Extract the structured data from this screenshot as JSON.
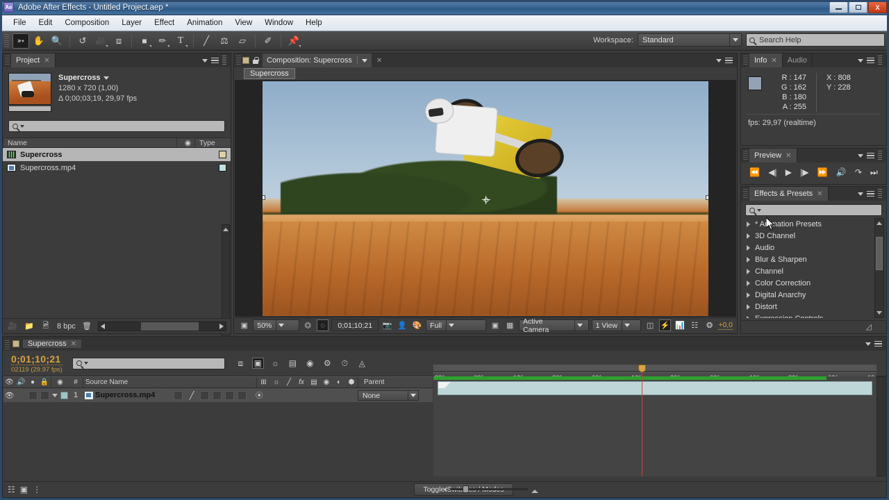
{
  "window": {
    "title": "Adobe After Effects - Untitled Project.aep *",
    "app_badge": "Ae",
    "minimize_label": "Minimize",
    "maximize_label": "Maximize",
    "close_label": "X"
  },
  "menubar": {
    "items": [
      "File",
      "Edit",
      "Composition",
      "Layer",
      "Effect",
      "Animation",
      "View",
      "Window",
      "Help"
    ]
  },
  "toolbar": {
    "tools": [
      {
        "name": "selection-tool",
        "glyph": "↖",
        "active": true
      },
      {
        "name": "hand-tool",
        "glyph": "✋",
        "active": false
      },
      {
        "name": "zoom-tool",
        "glyph": "🔍",
        "active": false
      },
      {
        "name": "rotation-tool",
        "glyph": "↺",
        "active": false
      },
      {
        "name": "camera-tool",
        "glyph": "🎥",
        "active": false
      },
      {
        "name": "pan-behind-tool",
        "glyph": "⬚",
        "active": false
      },
      {
        "name": "shape-tool",
        "glyph": "■",
        "active": false
      },
      {
        "name": "pen-tool",
        "glyph": "✒",
        "active": false
      },
      {
        "name": "type-tool",
        "glyph": "T",
        "active": false
      },
      {
        "name": "brush-tool",
        "glyph": "╱",
        "active": false
      },
      {
        "name": "clone-stamp-tool",
        "glyph": "⚙",
        "active": false
      },
      {
        "name": "eraser-tool",
        "glyph": "▱",
        "active": false
      },
      {
        "name": "roto-brush-tool",
        "glyph": "✐",
        "active": false
      },
      {
        "name": "puppet-pin-tool",
        "glyph": "📍",
        "active": false
      }
    ],
    "workspace_label": "Workspace:",
    "workspace_value": "Standard",
    "search_help_placeholder": "Search Help"
  },
  "project_panel": {
    "tab_label": "Project",
    "comp_name": "Supercross",
    "dimensions": "1280 x 720 (1,00)",
    "duration": "Δ 0;00;03;19, 29,97 fps",
    "search_placeholder": "",
    "columns": [
      "Name",
      "Type"
    ],
    "items": [
      {
        "name": "Supercross",
        "kind": "composition",
        "selected": true
      },
      {
        "name": "Supercross.mp4",
        "kind": "footage",
        "selected": false
      }
    ],
    "footer": {
      "bit_depth": "8 bpc",
      "new_comp_label": "New Composition",
      "new_folder_label": "New Folder",
      "interpret_footage_label": "Interpret Footage",
      "delete_label": "Delete"
    }
  },
  "composition_panel": {
    "tab_label": "Composition: Supercross",
    "breadcrumb": "Supercross",
    "footer": {
      "magnification": "50%",
      "current_time": "0;01;10;21",
      "resolution": "Full",
      "camera_view": "Active Camera",
      "view_layout": "1 View",
      "exposure": "+0,0",
      "take_snapshot_label": "Take Snapshot",
      "show_snapshot_label": "Show Snapshot",
      "show_channel_label": "Show Channel",
      "region_of_interest_label": "Region of Interest",
      "transparency_grid_label": "Toggle Transparency Grid",
      "title_safe_label": "Title/Action Safe",
      "fast_previews_label": "Fast Previews",
      "timeline_label": "Comp Flowchart",
      "grid_guides_label": "Grid and Guide Options"
    }
  },
  "info_panel": {
    "tabs": [
      {
        "label": "Info",
        "active": true
      },
      {
        "label": "Audio",
        "active": false
      }
    ],
    "r": "R : 147",
    "g": "G : 162",
    "b": "B : 180",
    "a": "A : 255",
    "x": "X : 808",
    "y": "Y : 228",
    "fps": "fps: 29,97 (realtime)",
    "swatch_color": "#93a2b4"
  },
  "preview_panel": {
    "tab_label": "Preview",
    "buttons": [
      {
        "name": "first-frame-button",
        "label": "First Frame"
      },
      {
        "name": "previous-frame-button",
        "label": "Previous Frame"
      },
      {
        "name": "play-button",
        "label": "Play"
      },
      {
        "name": "next-frame-button",
        "label": "Next Frame"
      },
      {
        "name": "last-frame-button",
        "label": "Last Frame"
      },
      {
        "name": "audio-button",
        "label": "Audio"
      },
      {
        "name": "loop-button",
        "label": "Loop"
      },
      {
        "name": "ram-preview-button",
        "label": "RAM Preview"
      }
    ]
  },
  "effects_panel": {
    "tab_label": "Effects & Presets",
    "search_placeholder": "",
    "categories": [
      "* Animation Presets",
      "3D Channel",
      "Audio",
      "Blur & Sharpen",
      "Channel",
      "Color Correction",
      "Digital Anarchy",
      "Distort",
      "Expression Controls"
    ]
  },
  "timeline_panel": {
    "tab_label": "Supercross",
    "timecode": "0;01;10;21",
    "frame_info": "02119 (29.97 fps)",
    "search_placeholder": "",
    "columns": [
      "#",
      "Source Name",
      "Parent"
    ],
    "switch_icons": [
      "shy",
      "collapse",
      "quality",
      "effects",
      "frame-blend",
      "motion-blur",
      "adjustment",
      "3d-layer"
    ],
    "layers": [
      {
        "index": "1",
        "source_name": "Supercross.mp4",
        "parent": "None",
        "visible": true,
        "audio": true,
        "color": "#9fc4c4"
      }
    ],
    "ruler_ticks": [
      "29f",
      "09f",
      "19f",
      "29f",
      "09f",
      "19f",
      "29f",
      "09f",
      "19f",
      "29f",
      "09f",
      "19"
    ],
    "toggle_switches_label": "Toggle Switches / Modes",
    "footer": {
      "comp_flowchart_label": "Comp Flowchart",
      "draft_3d_label": "Draft 3D",
      "graph_editor_label": "Graph Editor"
    }
  }
}
